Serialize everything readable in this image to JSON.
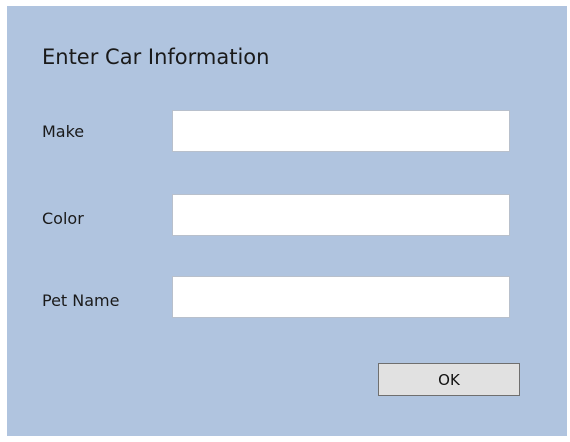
{
  "dialog": {
    "title": "Enter Car Information",
    "fields": [
      {
        "label": "Make",
        "value": ""
      },
      {
        "label": "Color",
        "value": ""
      },
      {
        "label": "Pet Name",
        "value": ""
      }
    ],
    "ok_label": "OK"
  },
  "colors": {
    "background": "#b0c4df",
    "input_background": "#ffffff",
    "button_background": "#e1e1e1"
  }
}
